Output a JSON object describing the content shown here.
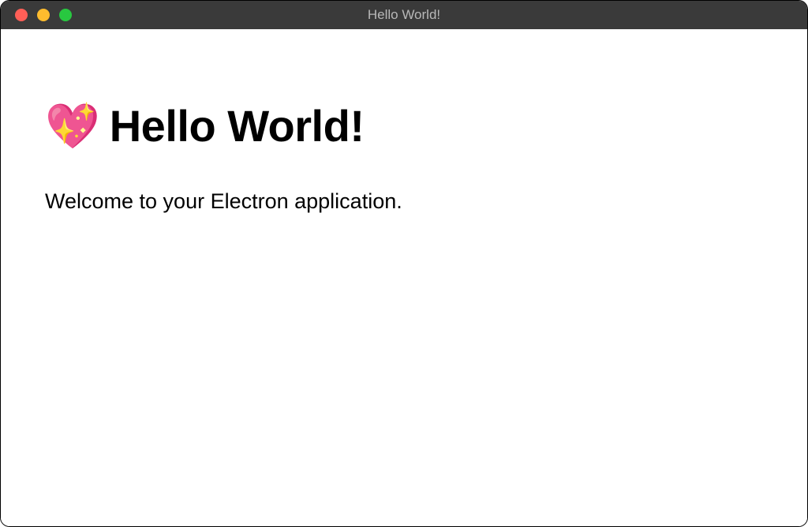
{
  "titlebar": {
    "title": "Hello World!"
  },
  "content": {
    "heart_emoji": "💖",
    "heading": "Hello World!",
    "welcome": "Welcome to your Electron application."
  }
}
